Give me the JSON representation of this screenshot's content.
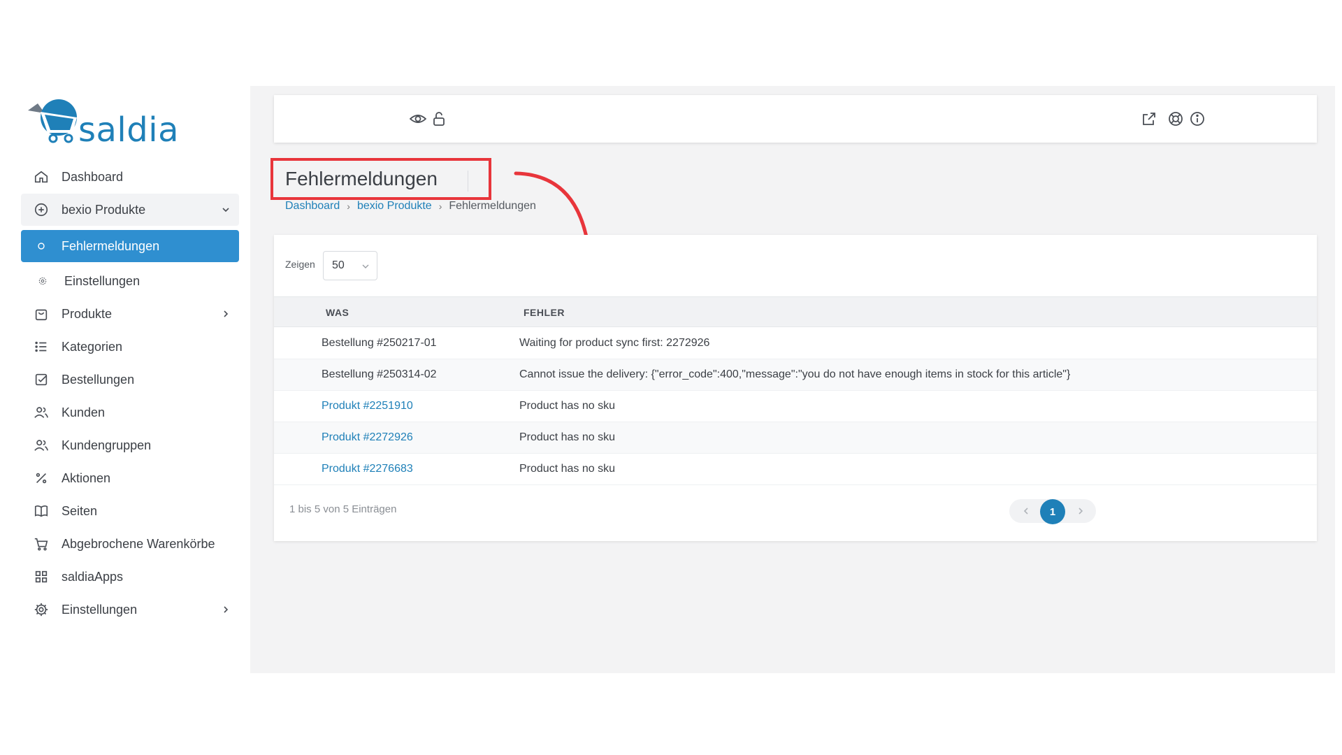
{
  "app": {
    "brand": "saldia"
  },
  "sidebar": {
    "items": [
      {
        "label": "Dashboard",
        "icon": "home-icon"
      },
      {
        "label": "bexio Produkte",
        "icon": "plus-circle-icon"
      },
      {
        "label": "Fehlermeldungen",
        "icon": "dot-icon"
      },
      {
        "label": "Einstellungen",
        "icon": "small-gear-icon"
      },
      {
        "label": "Produkte",
        "icon": "shopping-bag-icon"
      },
      {
        "label": "Kategorien",
        "icon": "list-icon"
      },
      {
        "label": "Bestellungen",
        "icon": "checkbox-icon"
      },
      {
        "label": "Kunden",
        "icon": "users-icon"
      },
      {
        "label": "Kundengruppen",
        "icon": "user-group-icon"
      },
      {
        "label": "Aktionen",
        "icon": "percent-icon"
      },
      {
        "label": "Seiten",
        "icon": "book-icon"
      },
      {
        "label": "Abgebrochene Warenkörbe",
        "icon": "cart-icon"
      },
      {
        "label": "saldiaApps",
        "icon": "grid-icon"
      },
      {
        "label": "Einstellungen",
        "icon": "gear-icon"
      }
    ]
  },
  "topbar": {
    "icons": [
      "eye-icon",
      "unlock-icon",
      "external-link-icon",
      "support-icon",
      "info-icon"
    ]
  },
  "page": {
    "title": "Fehlermeldungen",
    "breadcrumbs": [
      "Dashboard",
      "bexio Produkte",
      "Fehlermeldungen"
    ]
  },
  "table": {
    "show_label": "Zeigen",
    "page_size": "50",
    "columns": [
      "WAS",
      "FEHLER"
    ],
    "rows": [
      {
        "was": "Bestellung #250217-01",
        "fehler": "Waiting for product sync first: 2272926",
        "link": false
      },
      {
        "was": "Bestellung #250314-02",
        "fehler": "Cannot issue the delivery: {\"error_code\":400,\"message\":\"you do not have enough items in stock for this article\"}",
        "link": false
      },
      {
        "was": "Produkt #2251910",
        "fehler": "Product has no sku",
        "link": true
      },
      {
        "was": "Produkt #2272926",
        "fehler": "Product has no sku",
        "link": true
      },
      {
        "was": "Produkt #2276683",
        "fehler": "Product has no sku",
        "link": true
      }
    ],
    "info": "1 bis 5 von 5 Einträgen",
    "current_page": "1"
  },
  "colors": {
    "accent": "#2f8fd0",
    "link": "#1f80b8",
    "highlight": "#e8353b"
  }
}
